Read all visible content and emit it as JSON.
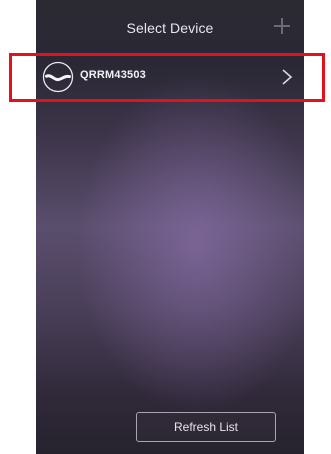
{
  "header": {
    "title": "Select Device",
    "add_icon": "plus-icon"
  },
  "devices": [
    {
      "name": "QRRM43503",
      "icon": "device-wave-icon",
      "chevron": "chevron-right-icon"
    }
  ],
  "footer": {
    "refresh_label": "Refresh List"
  },
  "highlight": {
    "color": "#e3111c"
  }
}
